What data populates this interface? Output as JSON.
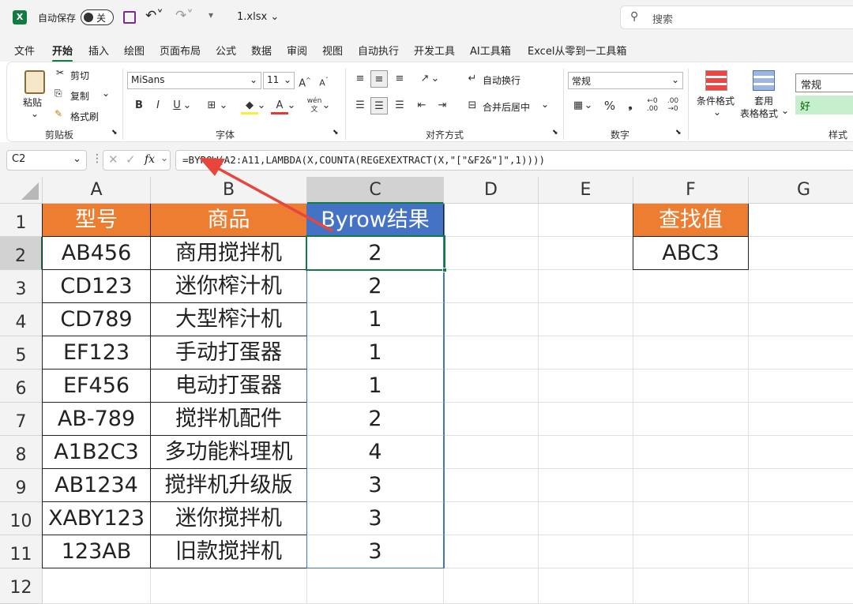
{
  "titlebar": {
    "autosave_label": "自动保存",
    "autosave_state": "关",
    "filename": "1.xlsx",
    "search_placeholder": "搜索"
  },
  "menu": [
    "文件",
    "开始",
    "插入",
    "绘图",
    "页面布局",
    "公式",
    "数据",
    "审阅",
    "视图",
    "自动执行",
    "开发工具",
    "AI工具箱",
    "Excel从零到一工具箱"
  ],
  "active_menu": "开始",
  "ribbon": {
    "clipboard": {
      "paste": "粘贴",
      "cut": "剪切",
      "copy": "复制",
      "format_painter": "格式刷",
      "group": "剪贴板"
    },
    "font": {
      "name": "MiSans",
      "size": "11",
      "group": "字体"
    },
    "alignment": {
      "wrap": "自动换行",
      "merge": "合并后居中",
      "group": "对齐方式"
    },
    "number": {
      "format": "常规",
      "group": "数字"
    },
    "styles": {
      "conditional": "条件格式",
      "table_format_1": "套用",
      "table_format_2": "表格格式",
      "style_normal": "常规",
      "style_good": "好",
      "group": "样式"
    }
  },
  "formula_bar": {
    "name_box": "C2",
    "fx": "fx",
    "formula": "=BYROW(A2:A11,LAMBDA(X,COUNTA(REGEXEXTRACT(X,\"[\"&F2&\"]\",1))))"
  },
  "columns": [
    "A",
    "B",
    "C",
    "D",
    "E",
    "F",
    "G"
  ],
  "rows": [
    "1",
    "2",
    "3",
    "4",
    "5",
    "6",
    "7",
    "8",
    "9",
    "10",
    "11",
    "12"
  ],
  "table": {
    "headers": [
      "型号",
      "商品",
      "Byrow结果"
    ],
    "data": [
      [
        "AB456",
        "商用搅拌机",
        "2"
      ],
      [
        "CD123",
        "迷你榨汁机",
        "2"
      ],
      [
        "CD789",
        "大型榨汁机",
        "1"
      ],
      [
        "EF123",
        "手动打蛋器",
        "1"
      ],
      [
        "EF456",
        "电动打蛋器",
        "1"
      ],
      [
        "AB-789",
        "搅拌机配件",
        "2"
      ],
      [
        "A1B2C3",
        "多功能料理机",
        "4"
      ],
      [
        "AB1234",
        "搅拌机升级版",
        "3"
      ],
      [
        "XABY123",
        "迷你搅拌机",
        "3"
      ],
      [
        "123AB",
        "旧款搅拌机",
        "3"
      ]
    ]
  },
  "lookup": {
    "header": "查找值",
    "value": "ABC3"
  },
  "colors": {
    "accent": "#107c41",
    "header_orange": "#ed7d31",
    "header_blue": "#4472c4",
    "arrow": "#e8453c"
  }
}
